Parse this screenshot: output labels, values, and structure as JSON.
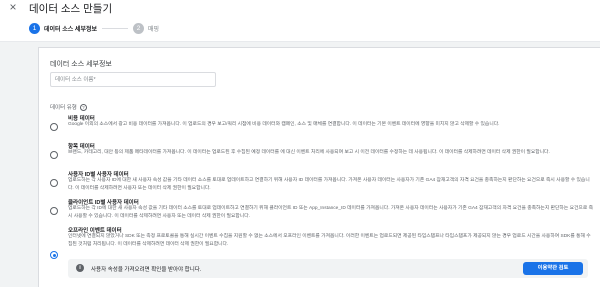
{
  "header": {
    "close_icon": "×",
    "title": "데이터 소스 만들기"
  },
  "stepper": {
    "steps": [
      {
        "number": "1",
        "label": "데이터 소스 세부정보"
      },
      {
        "number": "2",
        "label": "매핑"
      }
    ]
  },
  "form": {
    "section_title": "데이터 소스 세부정보",
    "name_placeholder": "데이터 소스 이름*",
    "type_label": "데이터 유형",
    "help_icon": "?",
    "options": [
      {
        "title": "비용 데이터",
        "desc": "Google 이외의 소스에서 광고 비용 데이터를 가져옵니다. 이 업로드의 경우 보고/쿼리 시점에 비용 데이터와 캠페인, 소스 및 매체를 연결합니다. 이 데이터는 기본 이벤트 데이터에 영향을 미치지 않고 삭제할 수 있습니다.",
        "checked": false
      },
      {
        "title": "항목 데이터",
        "desc": "브랜드, 카테고리, 대안 등의 제품 메타데이터를 가져옵니다. 이 데이터는 업로드된 후 수집된 예정 데이터를 에 대신 이벤트 처리에 사용되며 보고 시 이전 데이터를 수정하는 데 사용됩니다. 이 데이터를 삭제하려면 데이터 삭제 권한이 필요합니다.",
        "checked": false
      },
      {
        "title": "사용자 ID별 사용자 데이터",
        "desc": "업로드하는 각 사용자 ID에 대한 새 사용자 속성 값을 기타 데이터 소스를 토대로 업데이트하고 연결하기 위해 사용자 ID 데이터를 가져옵니다. 가져온 사용자 데이터는 사용자가 기존 GA4 잠재고객의 자격 요건을 충족하는지 판단하는 요건으로 즉시 사용할 수 있습니다. 이 데이터를 삭제하려면 사용자 또는 데이터 삭제 권한이 필요합니다.",
        "checked": false
      },
      {
        "title": "클라이언트 ID별 사용자 데이터",
        "desc": "업로드하는 각 ID에 대한 새 사용자 속성 값을 기타 데이터 소스를 토대로 업데이트하고 연결하기 위해 클라이언트 ID 또는 App_Instance_ID 데이터를 가져옵니다. 가져온 사용자 데이터는 사용자가 기존 GA4 잠재고객의 자격 요건을 충족하는지 판단하는 요건으로 즉시 사용할 수 있습니다. 이 데이터를 삭제하려면 사용자 또는 데이터 삭제 권한이 필요합니다.",
        "checked": false
      },
      {
        "title": "오프라인 이벤트 데이터",
        "desc": "인터넷에 연결되지 않았거나 SDK 또는 측정 프로토콜을 통해 실시간 이벤트 수집을 지원할 수 없는 소스에서 오프라인 이벤트를 가져옵니다. 이러한 이벤트는 업로드되면 제공된 타임스탬프나 타임스탬프가 제공되지 않는 경우 업로드 시간을 사용하여 SDK를 통해 수집된 것처럼 처리됩니다. 이 데이터를 삭제하려면 데이터 삭제 권한이 필요합니다.",
        "checked": true
      }
    ]
  },
  "banner": {
    "info_icon": "i",
    "text": "사용자 속성을 가져오려면 확인을 받아야 합니다.",
    "button_label": "이용약관 검토"
  },
  "colors": {
    "accent": "#1a73e8",
    "background": "#f1f3f4"
  }
}
